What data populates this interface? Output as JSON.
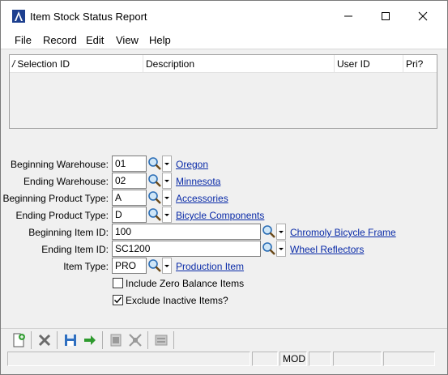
{
  "window": {
    "title": "Item Stock Status Report",
    "minimize_icon": "minimize-icon",
    "maximize_icon": "maximize-icon",
    "close_icon": "close-icon"
  },
  "menu": [
    "File",
    "Record",
    "Edit",
    "View",
    "Help"
  ],
  "grid": {
    "columns": [
      "Selection ID",
      "Description",
      "User ID",
      "Pri?"
    ],
    "rows": []
  },
  "form": {
    "beginning_warehouse": {
      "label": "Beginning Warehouse:",
      "value": "01",
      "link": "Oregon"
    },
    "ending_warehouse": {
      "label": "Ending Warehouse:",
      "value": "02",
      "link": "Minnesota"
    },
    "beginning_product_type": {
      "label": "Beginning Product Type:",
      "value": "A",
      "link": "Accessories"
    },
    "ending_product_type": {
      "label": "Ending Product Type:",
      "value": "D",
      "link": "Bicycle Components"
    },
    "beginning_item_id": {
      "label": "Beginning Item ID:",
      "value": "100",
      "link": "Chromoly Bicycle Frame"
    },
    "ending_item_id": {
      "label": "Ending Item ID:",
      "value": "SC1200",
      "link": "Wheel Reflectors"
    },
    "item_type": {
      "label": "Item Type:",
      "value": "PRO",
      "link": "Production Item"
    },
    "include_zero_balance": {
      "label": "Include Zero Balance Items",
      "checked": false
    },
    "exclude_inactive": {
      "label": "Exclude Inactive Items?",
      "checked": true
    }
  },
  "status": {
    "mode": "MOD"
  },
  "colors": {
    "link": "#0a2ba8",
    "window_bg": "#f0f0f0"
  }
}
